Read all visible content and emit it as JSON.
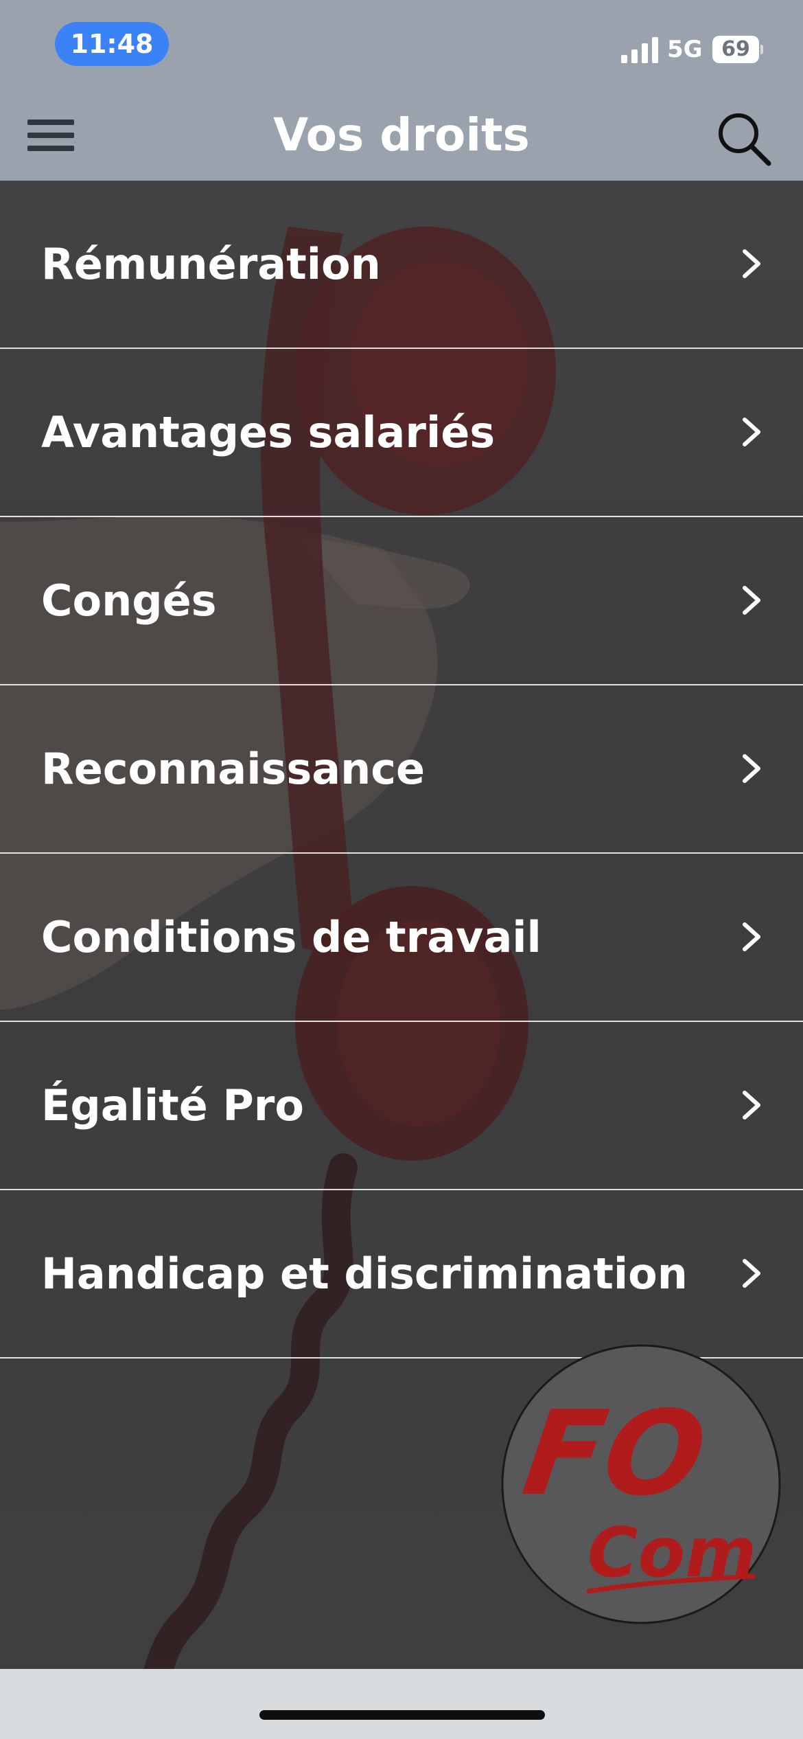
{
  "status_bar": {
    "time": "11:48",
    "network": "5G",
    "battery": "69",
    "time_pill_color": "#3b82f6"
  },
  "header": {
    "title": "Vos droits",
    "menu_icon": "hamburger-menu-icon",
    "search_icon": "search-icon",
    "background_color": "#9aa3ad"
  },
  "menu": {
    "items": [
      {
        "label": "Rémunération"
      },
      {
        "label": "Avantages salariés"
      },
      {
        "label": "Congés"
      },
      {
        "label": "Reconnaissance"
      },
      {
        "label": "Conditions de travail"
      },
      {
        "label": "Égalité Pro"
      },
      {
        "label": "Handicap et discrimination"
      }
    ],
    "item_icon": "chevron-right-icon"
  },
  "logo": {
    "line1": "FO",
    "line2": "Com",
    "color": "#b01c1c"
  }
}
